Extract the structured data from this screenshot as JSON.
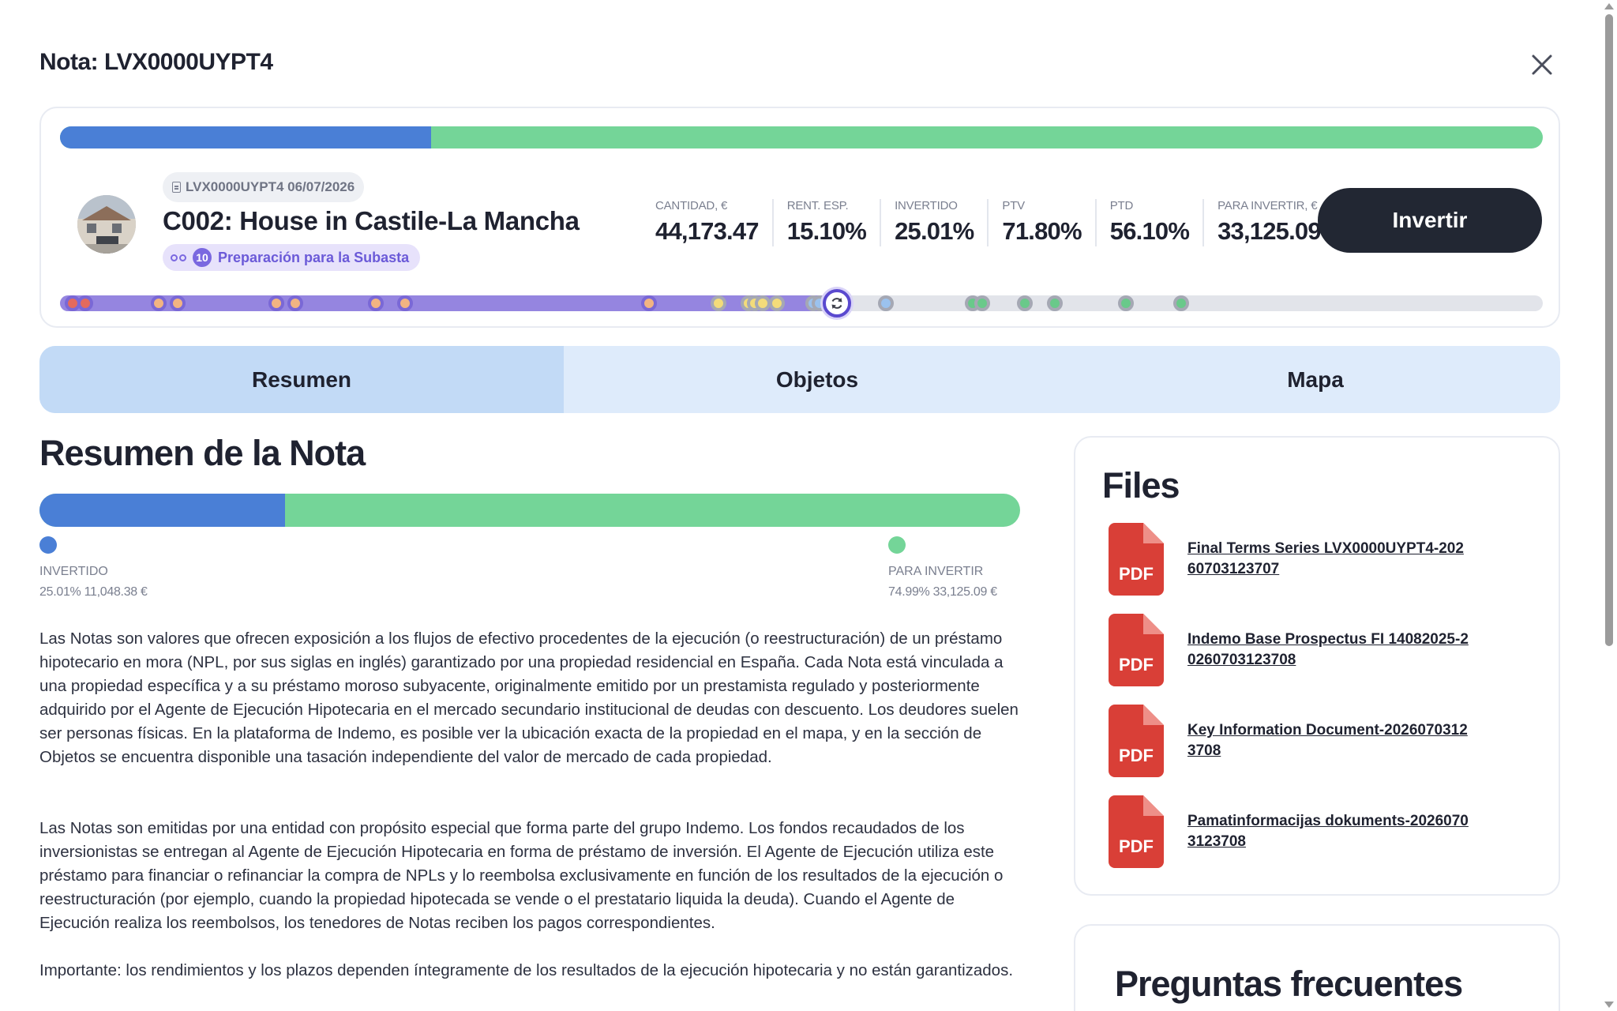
{
  "modal": {
    "title": "Nota: LVX0000UYPT4",
    "close_icon": "close-icon"
  },
  "header": {
    "invested_fraction": 0.2501,
    "code_label": "LVX0000UYPT4 06/07/2026",
    "property_name": "C002: House in Castile-La Mancha",
    "stage": {
      "number": "10",
      "label": "Preparación para la Subasta"
    },
    "stats": [
      {
        "label": "CANTIDAD, €",
        "value": "44,173.47"
      },
      {
        "label": "RENT. ESP.",
        "value": "15.10%"
      },
      {
        "label": "INVERTIDO",
        "value": "25.01%"
      },
      {
        "label": "PTV",
        "value": "71.80%"
      },
      {
        "label": "PTD",
        "value": "56.10%"
      },
      {
        "label": "PARA INVERTIR, €",
        "value": "33,125.09"
      }
    ],
    "invest_button": "Invertir",
    "timeline": {
      "progress_fraction": 0.526,
      "dot_colors": {
        "red": "#e46a5c",
        "orange": "#f2b482",
        "yellow": "#f3dc7a",
        "blue": "#9bc2ee",
        "green": "#69c98a"
      }
    }
  },
  "tabs": [
    {
      "label": "Resumen",
      "active": true
    },
    {
      "label": "Objetos",
      "active": false
    },
    {
      "label": "Mapa",
      "active": false
    }
  ],
  "summary": {
    "title": "Resumen de la Nota",
    "invested_fraction": 0.2501,
    "legend": {
      "invested": {
        "label": "INVERTIDO",
        "value": "25.01% 11,048.38 €",
        "color": "#4a7fd6"
      },
      "to_invest": {
        "label": "PARA INVERTIR",
        "value": "74.99% 33,125.09 €",
        "color": "#74d598"
      }
    },
    "paragraphs": [
      "Las Notas son valores que ofrecen exposición a los flujos de efectivo procedentes de la ejecución (o reestructuración) de un préstamo hipotecario en mora (NPL, por sus siglas en inglés) garantizado por una propiedad residencial en España. Cada Nota está vinculada a una propiedad específica y a su préstamo moroso subyacente, originalmente emitido por un prestamista regulado y posteriormente adquirido por el Agente de Ejecución Hipotecaria en el mercado secundario institucional de deudas con descuento. Los deudores suelen ser personas físicas. En la plataforma de Indemo, es posible ver la ubicación exacta de la propiedad en el mapa, y en la sección de Objetos se encuentra disponible una tasación independiente del valor de mercado de cada propiedad.",
      "Las Notas son emitidas por una entidad con propósito especial que forma parte del grupo Indemo. Los fondos recaudados de los inversionistas se entregan al Agente de Ejecución Hipotecaria en forma de préstamo de inversión. El Agente de Ejecución utiliza este préstamo para financiar o refinanciar la compra de NPLs y lo reembolsa exclusivamente en función de los resultados de la ejecución o reestructuración (por ejemplo, cuando la propiedad hipotecada se vende o el prestatario liquida la deuda). Cuando el Agente de Ejecución realiza los reembolsos, los tenedores de Notas reciben los pagos correspondientes.",
      "Importante: los rendimientos y los plazos dependen íntegramente de los resultados de la ejecución hipotecaria y no están garantizados."
    ]
  },
  "files": {
    "title": "Files",
    "icon": "pdf-file-icon",
    "badge": "PDF",
    "items": [
      "Final Terms Series LVX0000UYPT4-20260703123707",
      "Indemo Base Prospectus FI 14082025-20260703123708",
      "Key Information Document-20260703123708",
      "Pamatinformacijas dokuments-20260703123708"
    ]
  },
  "faq": {
    "title": "Preguntas frecuentes"
  }
}
